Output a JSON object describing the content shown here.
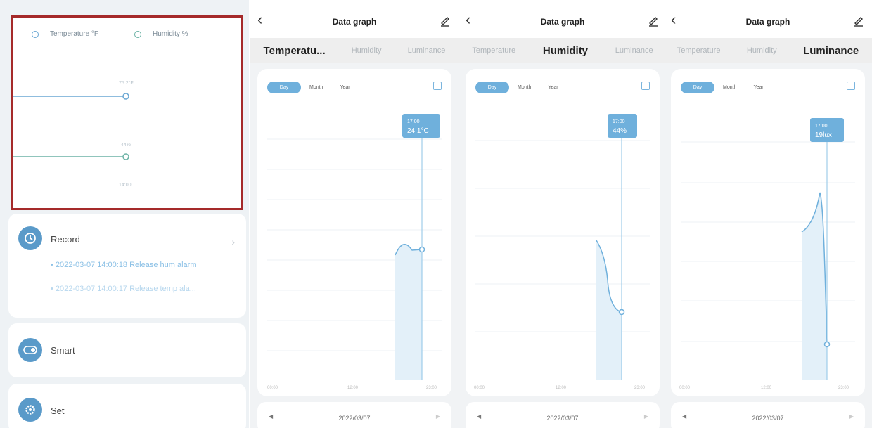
{
  "overview": {
    "legend_temperature": "Temperature °F",
    "legend_humidity": "Humidity %",
    "temp_value_label": "75.2°F",
    "hum_value_label": "44%",
    "time_label": "14:00"
  },
  "record": {
    "title": "Record",
    "items": [
      "• 2022-03-07 14:00:18 Release hum alarm",
      "• 2022-03-07 14:00:17 Release temp ala..."
    ]
  },
  "smart": {
    "title": "Smart"
  },
  "set": {
    "title": "Set"
  },
  "phones": [
    {
      "title": "Data graph",
      "tabs": [
        "Temperatu...",
        "Humidity",
        "Luminance"
      ],
      "active_tab": 0,
      "segments": [
        "Day",
        "Month",
        "Year"
      ],
      "tooltip_time": "17:00",
      "tooltip_value": "24.1°C",
      "x_ticks": [
        "00:00",
        "12:00",
        "23:00"
      ],
      "date": "2022/03/07"
    },
    {
      "title": "Data graph",
      "tabs": [
        "Temperature",
        "Humidity",
        "Luminance"
      ],
      "active_tab": 1,
      "segments": [
        "Day",
        "Month",
        "Year"
      ],
      "tooltip_time": "17:00",
      "tooltip_value": "44%",
      "x_ticks": [
        "00:00",
        "12:00",
        "23:00"
      ],
      "date": "2022/03/07"
    },
    {
      "title": "Data graph",
      "tabs": [
        "Temperature",
        "Humidity",
        "Luminance"
      ],
      "active_tab": 2,
      "segments": [
        "Day",
        "Month",
        "Year"
      ],
      "tooltip_time": "17:00",
      "tooltip_value": "19lux",
      "x_ticks": [
        "00:00",
        "12:00",
        "23:00"
      ],
      "date": "2022/03/07"
    }
  ],
  "colors": {
    "accent": "#6fb0dc",
    "alert_border": "#a52a2a",
    "temp_line": "#6aa7d3",
    "hum_line": "#6bb2a5"
  }
}
